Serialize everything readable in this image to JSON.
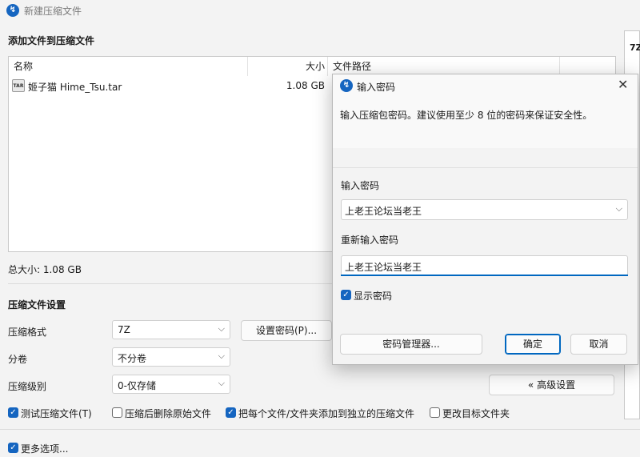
{
  "window": {
    "title": "新建压缩文件"
  },
  "files_section": {
    "heading": "添加文件到压缩文件",
    "columns": {
      "name": "名称",
      "size": "大小",
      "path": "文件路径"
    },
    "rows": [
      {
        "icon_label": "TAR",
        "name": "姬子猫 Hime_Tsu.tar",
        "size": "1.08 GB"
      }
    ],
    "total_size": "总大小: 1.08 GB"
  },
  "settings": {
    "heading": "压缩文件设置",
    "format_label": "压缩格式",
    "format_value": "7Z",
    "volume_label": "分卷",
    "volume_value": "不分卷",
    "level_label": "压缩级别",
    "level_value": "0-仅存储",
    "set_password_button": "设置密码(P)...",
    "advanced_button": "« 高级设置"
  },
  "options": [
    {
      "label": "测试压缩文件(T)",
      "checked": true
    },
    {
      "label": "压缩后删除原始文件",
      "checked": false
    },
    {
      "label": "把每个文件/文件夹添加到独立的压缩文件",
      "checked": true
    },
    {
      "label": "更改目标文件夹",
      "checked": false
    }
  ],
  "more_options": {
    "label": "更多选项...",
    "checked": true
  },
  "right_panel": {
    "top_label": "7Z"
  },
  "password_dialog": {
    "title": "输入密码",
    "description": "输入压缩包密码。建议使用至少 8 位的密码来保证安全性。",
    "password_label": "输入密码",
    "password_value": "上老王论坛当老王",
    "confirm_label": "重新输入密码",
    "confirm_value": "上老王论坛当老王",
    "show_password_label": "显示密码",
    "show_password_checked": true,
    "manager_button": "密码管理器...",
    "ok_button": "确定",
    "cancel_button": "取消"
  },
  "colors": {
    "accent": "#0067c0",
    "background": "#f3f3f3"
  }
}
